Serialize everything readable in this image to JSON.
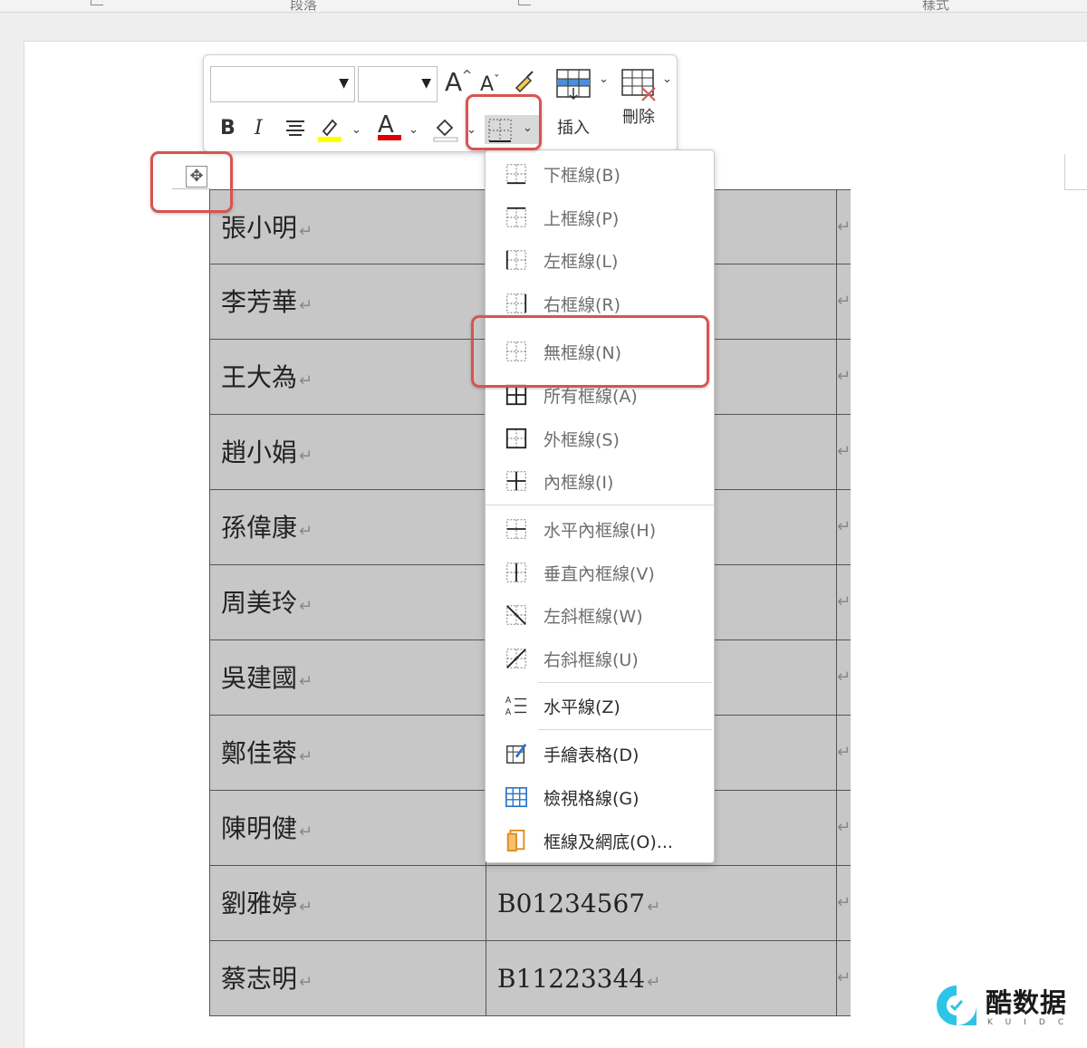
{
  "ribbon": {
    "groups": [
      "段落",
      "樣式"
    ]
  },
  "mini_toolbar": {
    "font_name": "",
    "font_size": "",
    "grow_font": "A",
    "shrink_font": "A",
    "bold": "B",
    "italic": "I",
    "font_color_glyph": "A",
    "insert_label": "插入",
    "delete_label": "刪除"
  },
  "table": {
    "rows": [
      {
        "name": "張小明",
        "id": ""
      },
      {
        "name": "李芳華",
        "id": ""
      },
      {
        "name": "王大為",
        "id": ""
      },
      {
        "name": "趙小娟",
        "id": ""
      },
      {
        "name": "孫偉康",
        "id": ""
      },
      {
        "name": "周美玲",
        "id": ""
      },
      {
        "name": "吳建國",
        "id": ""
      },
      {
        "name": "鄭佳蓉",
        "id": ""
      },
      {
        "name": "陳明健",
        "id": ""
      },
      {
        "name": "劉雅婷",
        "id": "B01234567"
      },
      {
        "name": "蔡志明",
        "id": "B11223344"
      }
    ],
    "paragraph_mark": "↵"
  },
  "borders_menu": {
    "items": [
      {
        "label": "下框線(B)",
        "icon": "bottom-border-icon"
      },
      {
        "label": "上框線(P)",
        "icon": "top-border-icon"
      },
      {
        "label": "左框線(L)",
        "icon": "left-border-icon"
      },
      {
        "label": "右框線(R)",
        "icon": "right-border-icon"
      },
      {
        "label": "無框線(N)",
        "icon": "no-border-icon"
      },
      {
        "label": "所有框線(A)",
        "icon": "all-borders-icon"
      },
      {
        "label": "外框線(S)",
        "icon": "outside-borders-icon"
      },
      {
        "label": "內框線(I)",
        "icon": "inside-borders-icon"
      },
      {
        "label": "水平內框線(H)",
        "icon": "inside-horizontal-border-icon"
      },
      {
        "label": "垂直內框線(V)",
        "icon": "inside-vertical-border-icon"
      },
      {
        "label": "左斜框線(W)",
        "icon": "diagonal-down-border-icon"
      },
      {
        "label": "右斜框線(U)",
        "icon": "diagonal-up-border-icon"
      },
      {
        "label": "水平線(Z)",
        "icon": "horizontal-line-icon"
      },
      {
        "label": "手繪表格(D)",
        "icon": "draw-table-icon"
      },
      {
        "label": "檢視格線(G)",
        "icon": "view-gridlines-icon"
      },
      {
        "label": "框線及網底(O)...",
        "icon": "borders-shading-icon"
      }
    ]
  },
  "watermark": {
    "title": "酷数据",
    "subtitle": "KUIDC"
  },
  "colors": {
    "highlight_box": "#d9534f",
    "cell_fill": "#c7c7c7",
    "text_highlight": "#ffff00",
    "font_color": "#e00000"
  }
}
